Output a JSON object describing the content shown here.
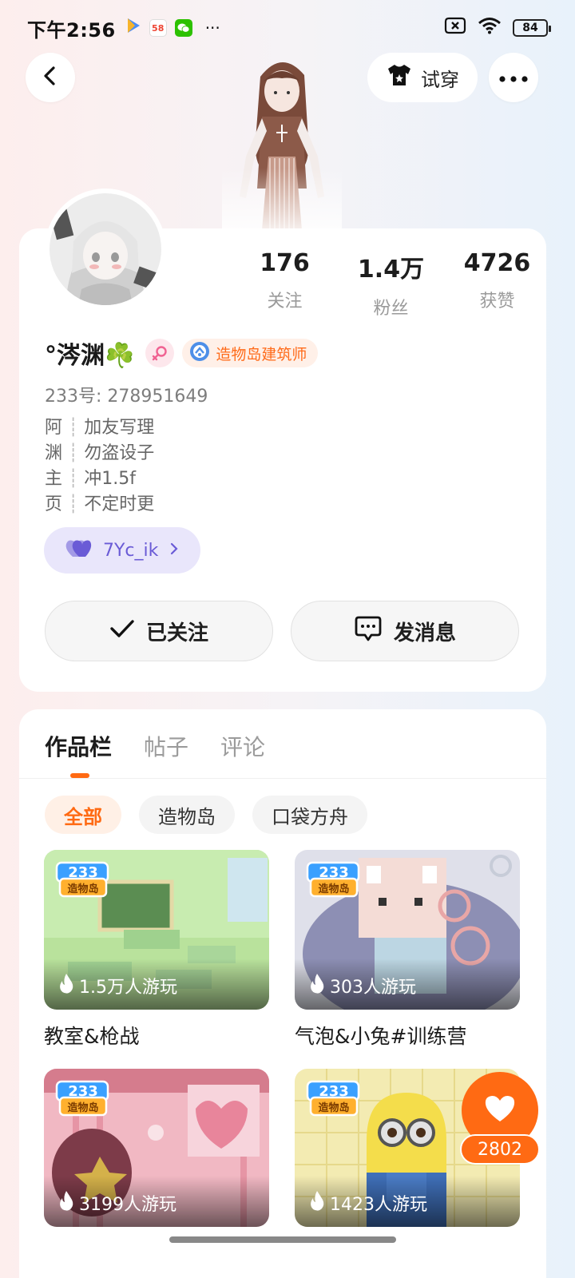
{
  "status_bar": {
    "time": "下午2:56",
    "app_58": "58",
    "more": "···",
    "battery": "84"
  },
  "header": {
    "back_icon": "back-arrow-icon",
    "try_on_label": "试穿",
    "more_icon": "more-horizontal-icon"
  },
  "profile": {
    "stats": [
      {
        "value": "176",
        "label": "关注"
      },
      {
        "value": "1.4万",
        "label": "粉丝"
      },
      {
        "value": "4726",
        "label": "获赞"
      }
    ],
    "nickname": "°涔渊☘️",
    "title_badge": "造物岛建筑师",
    "user_id": "233号: 278951649",
    "bio": [
      {
        "char": "阿",
        "text": "加友写理"
      },
      {
        "char": "渊",
        "text": "勿盗设子"
      },
      {
        "char": "主",
        "text": "冲1.5f"
      },
      {
        "char": "页",
        "text": "不定时更"
      }
    ],
    "bio_separator": "┊",
    "fan_tag": "7Yc_ik",
    "followed_label": "已关注",
    "message_label": "发消息"
  },
  "works": {
    "tabs": [
      "作品栏",
      "帖子",
      "评论"
    ],
    "filters": [
      "全部",
      "造物岛",
      "口袋方舟"
    ],
    "logo_text": "233 造物岛",
    "games": [
      {
        "title": "教室&枪战",
        "plays": "1.5万人游玩"
      },
      {
        "title": "气泡&小兔#训练营",
        "plays": "303人游玩"
      },
      {
        "title": "",
        "plays": "3199人游玩"
      },
      {
        "title": "",
        "plays": "1423人游玩"
      }
    ]
  },
  "like_fab": {
    "count": "2802"
  },
  "colors": {
    "accent": "#ff6a13",
    "fan_tag": "#6a5bd6"
  }
}
